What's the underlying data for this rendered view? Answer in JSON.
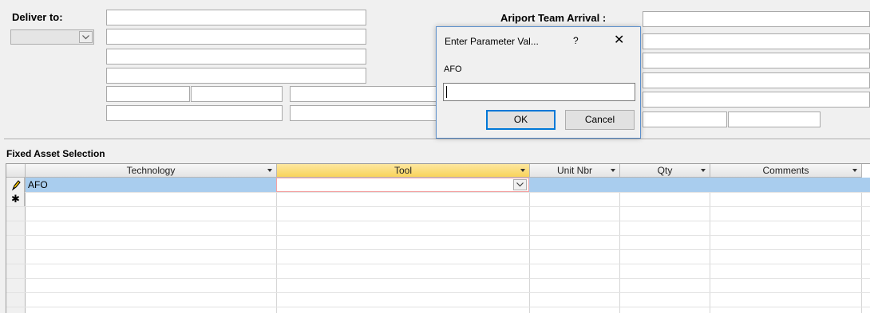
{
  "deliver_to": {
    "label": "Deliver to:",
    "combo_value": ""
  },
  "airport": {
    "label": "Ariport Team Arrival :"
  },
  "section": {
    "title": "Fixed Asset Selection"
  },
  "grid": {
    "columns": [
      "Technology",
      "Tool",
      "Unit Nbr",
      "Qty",
      "Comments"
    ],
    "selected_column": "Tool",
    "rows": [
      {
        "Technology": "AFO",
        "Tool": "",
        "Unit Nbr": "",
        "Qty": "",
        "Comments": ""
      }
    ],
    "row_selector_icons": [
      "pencil-icon",
      "new-row-asterisk-icon"
    ],
    "new_row_marker": "✱"
  },
  "dialog": {
    "title": "Enter Parameter Val...",
    "help": "?",
    "close": "✕",
    "prompt": "AFO",
    "input_value": "",
    "ok_label": "OK",
    "cancel_label": "Cancel"
  },
  "colors": {
    "active_row": "#a9cdee",
    "selected_header": "#f9d35a",
    "dialog_border": "#5c8fcb",
    "default_button_border": "#0078d7"
  }
}
